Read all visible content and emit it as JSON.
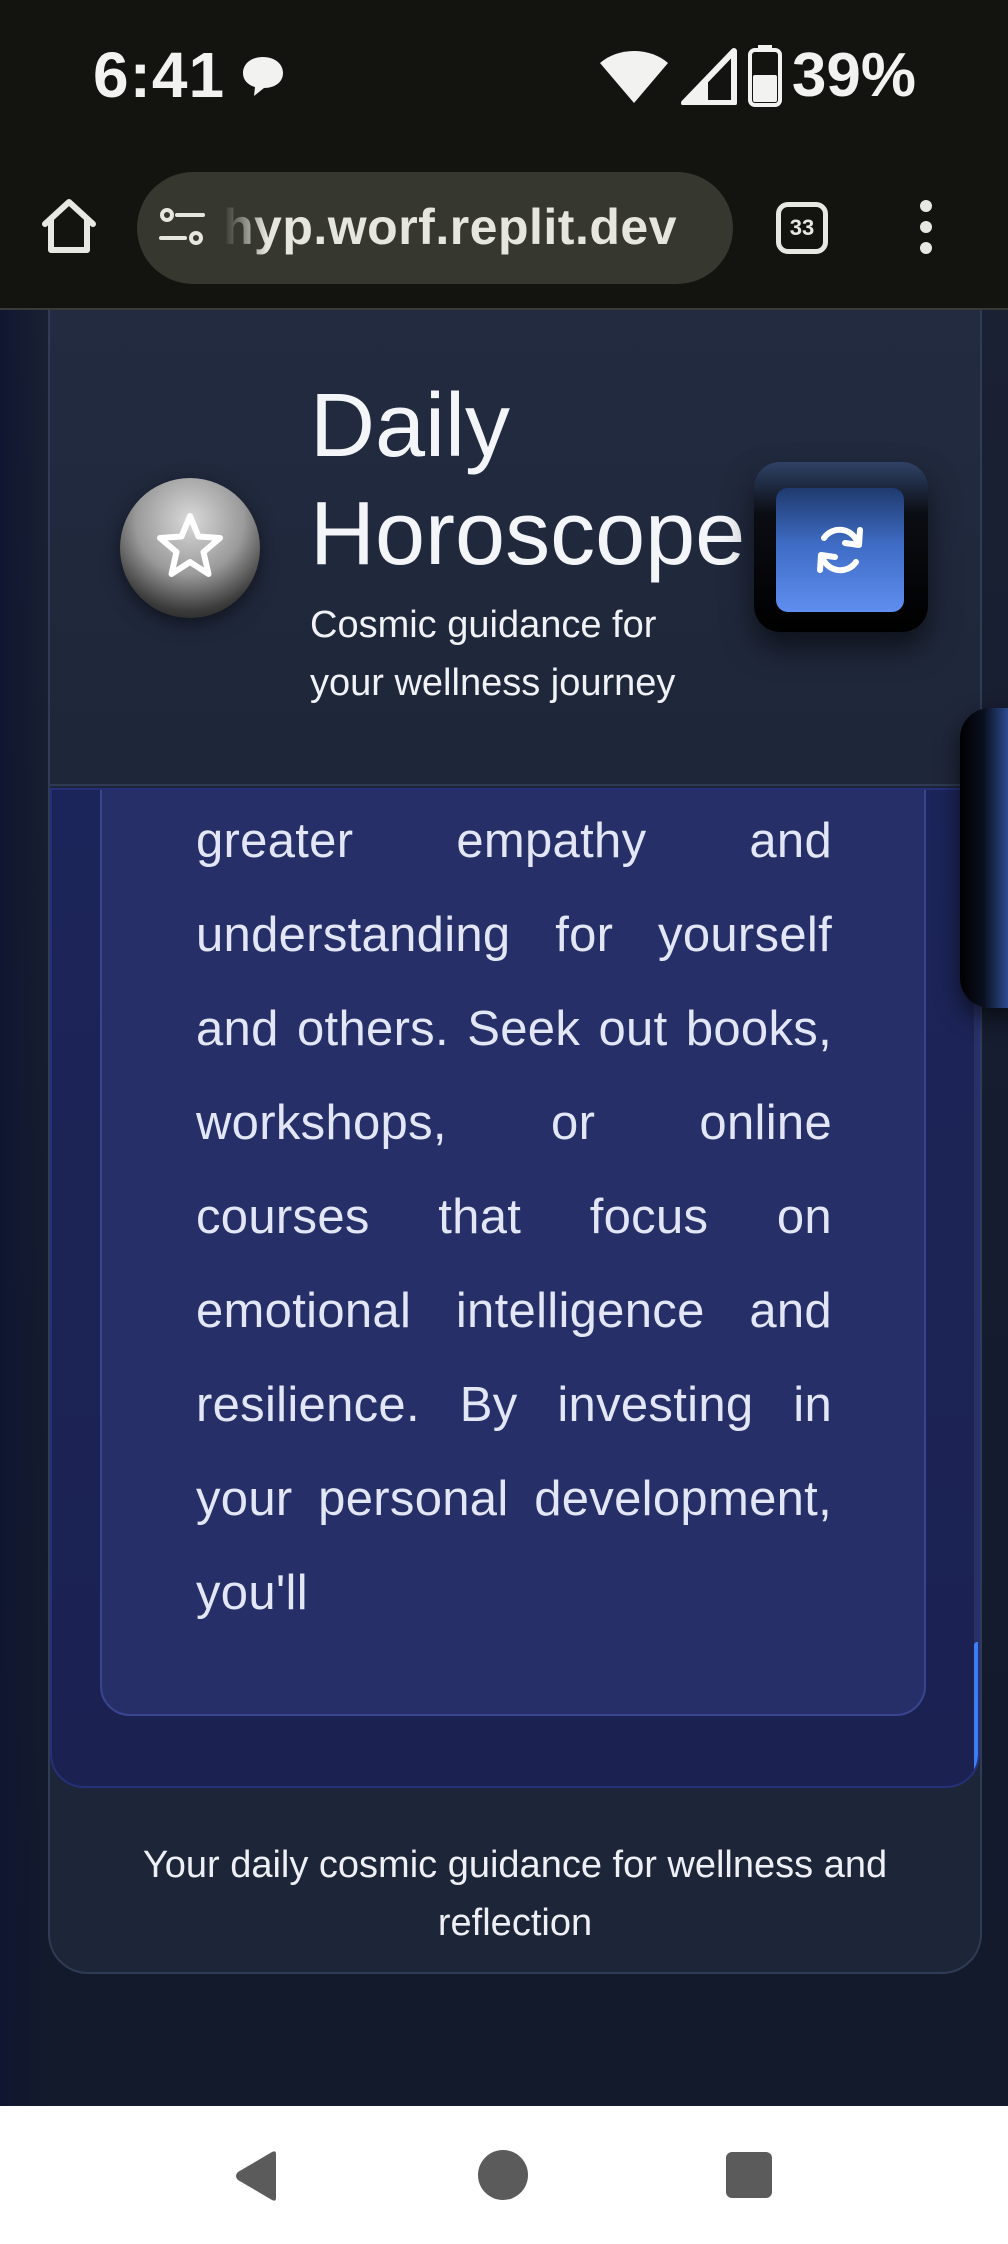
{
  "status_bar": {
    "time": "6:41",
    "battery": "39%"
  },
  "browser": {
    "url": "hyp.worf.replit.dev",
    "tab_count": "33"
  },
  "header": {
    "title": "Daily Horoscope",
    "subtitle": "Cosmic guidance for your wellness journey"
  },
  "reading": {
    "text": "greater empathy and understanding for yourself and others. Seek out books, workshops, or online courses that focus on emotional intelligence and resilience. By investing in your personal development, you'll"
  },
  "footer": {
    "text": "Your daily cosmic guidance for wellness and reflection"
  },
  "icons": {
    "status": [
      "chat-bubble-icon",
      "wifi-icon",
      "cell-signal-icon",
      "battery-icon"
    ],
    "browser": [
      "home-icon",
      "site-settings-icon",
      "tabs-icon",
      "more-menu-icon"
    ],
    "page": [
      "star-icon",
      "refresh-icon"
    ],
    "nav": [
      "back-icon",
      "home-icon",
      "recents-icon"
    ]
  },
  "colors": {
    "accent_blue": "#5f8ef0",
    "panel": "#262f68",
    "background": "#141a2c"
  }
}
